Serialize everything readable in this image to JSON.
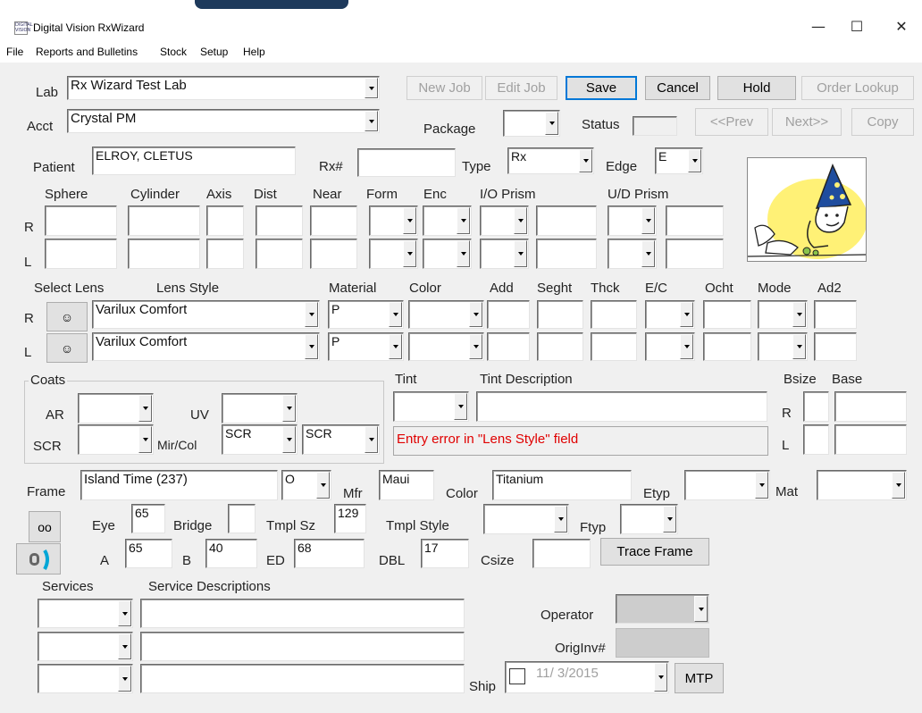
{
  "window": {
    "title": "Digital Vision RxWizard",
    "icon_text": "DIGITAL VISION",
    "minimize": "—",
    "maximize": "☐",
    "close": "✕"
  },
  "menu": [
    "File",
    "Reports and Bulletins",
    "Stock",
    "Setup",
    "Help"
  ],
  "header": {
    "lab_label": "Lab",
    "lab_value": "Rx Wizard Test Lab",
    "acct_label": "Acct",
    "acct_value": "Crystal PM",
    "package_label": "Package",
    "package_value": "",
    "status_label": "Status",
    "status_value": "",
    "buttons": {
      "new_job": "New Job",
      "edit_job": "Edit Job",
      "save": "Save",
      "cancel": "Cancel",
      "hold": "Hold",
      "order_lookup": "Order Lookup",
      "prev": "<<Prev",
      "next": "Next>>",
      "copy": "Copy"
    }
  },
  "patient": {
    "patient_label": "Patient",
    "patient_value": "ELROY, CLETUS",
    "rx_label": "Rx#",
    "rx_value": "",
    "type_label": "Type",
    "type_value": "Rx",
    "edge_label": "Edge",
    "edge_value": "E"
  },
  "rx_grid": {
    "headers": {
      "sphere": "Sphere",
      "cylinder": "Cylinder",
      "axis": "Axis",
      "dist": "Dist",
      "near": "Near",
      "form": "Form",
      "enc": "Enc",
      "io_prism": "I/O Prism",
      "ud_prism": "U/D Prism"
    },
    "row_r": "R",
    "row_l": "L"
  },
  "lens": {
    "headers": {
      "select_lens": "Select Lens",
      "lens_style": "Lens Style",
      "material": "Material",
      "color": "Color",
      "add": "Add",
      "seght": "Seght",
      "thck": "Thck",
      "ec": "E/C",
      "ocht": "Ocht",
      "mode": "Mode",
      "ad2": "Ad2"
    },
    "row_r": "R",
    "row_l": "L",
    "r_style": "Varilux Comfort",
    "l_style": "Varilux Comfort",
    "r_material": "P",
    "l_material": "P",
    "select_icon": "☺"
  },
  "coats": {
    "group_label": "Coats",
    "ar_label": "AR",
    "uv_label": "UV",
    "scr_label": "SCR",
    "mircol_label": "Mir/Col",
    "mircol_value1": "SCR",
    "mircol_value2": "SCR"
  },
  "tint": {
    "tint_label": "Tint",
    "desc_label": "Tint Description",
    "error_message": "Entry error in \"Lens Style\" field",
    "bsize_label": "Bsize",
    "base_label": "Base",
    "row_r": "R",
    "row_l": "L"
  },
  "frame": {
    "frame_label": "Frame",
    "frame_value": "Island Time (237)",
    "frame_code": "O",
    "mfr_label": "Mfr",
    "mfr_value": "Maui",
    "color_label": "Color",
    "color_value": "Titanium",
    "etyp_label": "Etyp",
    "mat_label": "Mat",
    "eye_label": "Eye",
    "eye_value": "65",
    "bridge_label": "Bridge",
    "bridge_value": "",
    "tmpl_sz_label": "Tmpl Sz",
    "tmpl_sz_value": "129",
    "tmpl_style_label": "Tmpl Style",
    "ftyp_label": "Ftyp",
    "a_label": "A",
    "a_value": "65",
    "b_label": "B",
    "b_value": "40",
    "ed_label": "ED",
    "ed_value": "68",
    "dbl_label": "DBL",
    "dbl_value": "17",
    "csize_label": "Csize",
    "csize_value": "",
    "trace_button": "Trace Frame",
    "glasses_icon": "oo"
  },
  "services": {
    "services_label": "Services",
    "desc_label": "Service Descriptions",
    "operator_label": "Operator",
    "originv_label": "OrigInv#",
    "ship_label": "Ship",
    "ship_date": "11/ 3/2015",
    "mtp_button": "MTP"
  }
}
